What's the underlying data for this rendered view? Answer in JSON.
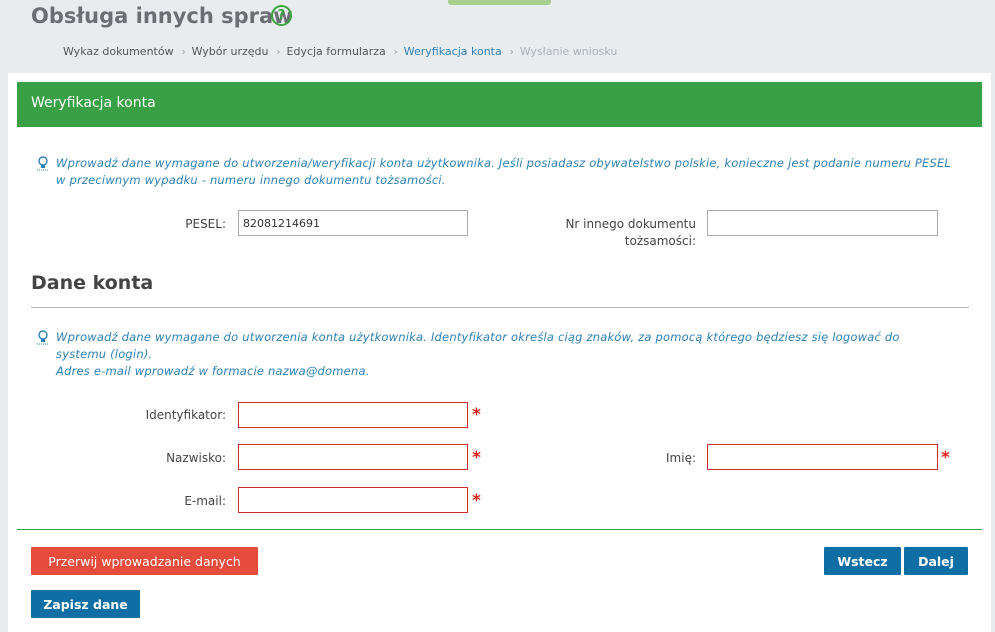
{
  "header": {
    "title": "Obsługa innych spraw",
    "help_icon": "?",
    "breadcrumb": [
      {
        "label": "Wykaz dokumentów",
        "state": "done"
      },
      {
        "label": "Wybór urzędu",
        "state": "done"
      },
      {
        "label": "Edycja formularza",
        "state": "done"
      },
      {
        "label": "Weryfikacja konta",
        "state": "active"
      },
      {
        "label": "Wysłanie wniosku",
        "state": "future"
      }
    ]
  },
  "panel": {
    "title": "Weryfikacja konta",
    "info1": "Wprowadź dane wymagane do utworzenia/weryfikacji konta użytkownika. Jeśli posiadasz obywatelstwo polskie, konieczne jest podanie numeru PESEL w przeciwnym wypadku - numeru innego dokumentu tożsamości.",
    "pesel_label": "PESEL:",
    "pesel_value": "82081214691",
    "other_doc_label_1": "Nr innego dokumentu",
    "other_doc_label_2": "tożsamości:",
    "other_doc_value": "",
    "section_title": "Dane konta",
    "info2_line1": "Wprowadź dane wymagane do utworzenia konta użytkownika. Identyfikator określa ciąg znaków, za pomocą którego będziesz się logować do",
    "info2_line2": "systemu (login).",
    "info2_line3": "Adres e-mail wprowadź w formacie nazwa@domena.",
    "identyfikator_label": "Identyfikator:",
    "nazwisko_label": "Nazwisko:",
    "imie_label": "Imię:",
    "email_label": "E-mail:",
    "required_mark": "*"
  },
  "buttons": {
    "cancel": "Przerwij wprowadzanie danych",
    "back": "Wstecz",
    "next": "Dalej",
    "save": "Zapisz dane"
  },
  "colors": {
    "accent_green": "#39a046",
    "primary_blue": "#0f6fa5",
    "danger_red": "#e64c3c",
    "info_blue": "#2e80b3"
  }
}
